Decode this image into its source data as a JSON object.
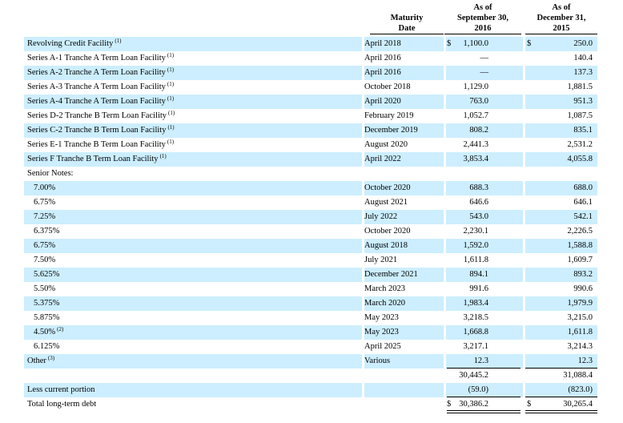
{
  "headers": {
    "maturity": [
      "Maturity",
      "Date"
    ],
    "col1": [
      "As of",
      "September 30,",
      "2016"
    ],
    "col2": [
      "As of",
      "December 31,",
      "2015"
    ]
  },
  "rows": [
    {
      "label": "Revolving Credit Facility",
      "note": "(1)",
      "maturity": "April 2018",
      "d1": "$",
      "v1": "1,100.0",
      "d2": "$",
      "v2": "250.0",
      "shade": true
    },
    {
      "label": "Series A-1 Tranche A Term Loan Facility",
      "note": "(1)",
      "maturity": "April 2016",
      "v1": "—",
      "v2": "140.4",
      "shade": false
    },
    {
      "label": "Series A-2 Tranche A Term Loan Facility",
      "note": "(1)",
      "maturity": "April 2016",
      "v1": "—",
      "v2": "137.3",
      "shade": true
    },
    {
      "label": "Series A-3 Tranche A Term Loan Facility",
      "note": "(1)",
      "maturity": "October 2018",
      "v1": "1,129.0",
      "v2": "1,881.5",
      "shade": false
    },
    {
      "label": "Series A-4 Tranche A Term Loan Facility",
      "note": "(1)",
      "maturity": "April 2020",
      "v1": "763.0",
      "v2": "951.3",
      "shade": true
    },
    {
      "label": "Series D-2 Tranche B Term Loan Facility",
      "note": "(1)",
      "maturity": "February 2019",
      "v1": "1,052.7",
      "v2": "1,087.5",
      "shade": false
    },
    {
      "label": "Series C-2 Tranche B Term Loan Facility",
      "note": "(1)",
      "maturity": "December 2019",
      "v1": "808.2",
      "v2": "835.1",
      "shade": true
    },
    {
      "label": "Series E-1 Tranche B Term Loan Facility",
      "note": "(1)",
      "maturity": "August 2020",
      "v1": "2,441.3",
      "v2": "2,531.2",
      "shade": false
    },
    {
      "label": "Series F Tranche B Term Loan Facility",
      "note": "(1)",
      "maturity": "April 2022",
      "v1": "3,853.4",
      "v2": "4,055.8",
      "shade": true
    },
    {
      "label": "Senior Notes:",
      "shade": false
    },
    {
      "label": "7.00%",
      "indent": true,
      "maturity": "October 2020",
      "v1": "688.3",
      "v2": "688.0",
      "shade": true
    },
    {
      "label": "6.75%",
      "indent": true,
      "maturity": "August 2021",
      "v1": "646.6",
      "v2": "646.1",
      "shade": false
    },
    {
      "label": "7.25%",
      "indent": true,
      "maturity": "July 2022",
      "v1": "543.0",
      "v2": "542.1",
      "shade": true
    },
    {
      "label": "6.375%",
      "indent": true,
      "maturity": "October 2020",
      "v1": "2,230.1",
      "v2": "2,226.5",
      "shade": false
    },
    {
      "label": "6.75%",
      "indent": true,
      "maturity": "August 2018",
      "v1": "1,592.0",
      "v2": "1,588.8",
      "shade": true
    },
    {
      "label": "7.50%",
      "indent": true,
      "maturity": "July 2021",
      "v1": "1,611.8",
      "v2": "1,609.7",
      "shade": false
    },
    {
      "label": "5.625%",
      "indent": true,
      "maturity": "December 2021",
      "v1": "894.1",
      "v2": "893.2",
      "shade": true
    },
    {
      "label": "5.50%",
      "indent": true,
      "maturity": "March 2023",
      "v1": "991.6",
      "v2": "990.6",
      "shade": false
    },
    {
      "label": "5.375%",
      "indent": true,
      "maturity": "March 2020",
      "v1": "1,983.4",
      "v2": "1,979.9",
      "shade": true
    },
    {
      "label": "5.875%",
      "indent": true,
      "maturity": "May 2023",
      "v1": "3,218.5",
      "v2": "3,215.0",
      "shade": false
    },
    {
      "label": "4.50%",
      "note": "(2)",
      "indent": true,
      "maturity": "May 2023",
      "v1": "1,668.8",
      "v2": "1,611.8",
      "shade": true
    },
    {
      "label": "6.125%",
      "indent": true,
      "maturity": "April 2025",
      "v1": "3,217.1",
      "v2": "3,214.3",
      "shade": false
    },
    {
      "label": "Other",
      "note": "(3)",
      "maturity": "Various",
      "v1": "12.3",
      "v2": "12.3",
      "shade": true
    },
    {
      "label": "",
      "v1": "30,445.2",
      "v2": "31,088.4",
      "shade": false
    },
    {
      "label": "Less current portion",
      "v1": "(59.0)",
      "v2": "(823.0)",
      "shade": true
    },
    {
      "label": "Total long-term debt",
      "d1": "$",
      "v1": "30,386.2",
      "d2": "$",
      "v2": "30,265.4",
      "shade": false
    }
  ]
}
